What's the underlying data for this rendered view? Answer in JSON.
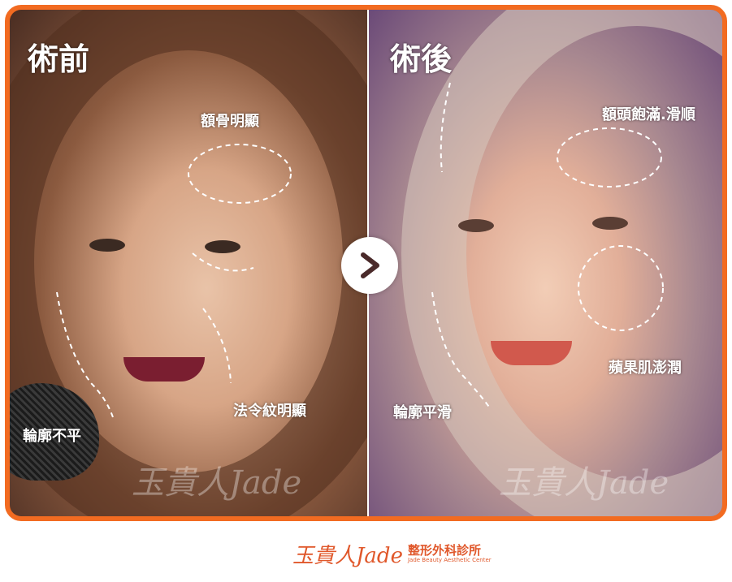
{
  "before": {
    "title": "術前",
    "notes": {
      "cheekbone": "額骨明顯",
      "nasolabial": "法令紋明顯",
      "contour": "輪廓不平"
    }
  },
  "after": {
    "title": "術後",
    "notes": {
      "forehead": "額頭飽滿.滑順",
      "apple_cheek": "蘋果肌澎潤",
      "contour": "輪廓平滑"
    }
  },
  "watermark": "玉貴人Jade",
  "footer": {
    "brand": "玉貴人Jade",
    "clinic_cn": "整形外科診所",
    "clinic_en": "Jade Beauty Aesthetic Center"
  },
  "colors": {
    "accent": "#f26b21",
    "arrow": "#4a2a2a"
  },
  "icons": {
    "compare_arrow": "chevron-right-icon"
  }
}
